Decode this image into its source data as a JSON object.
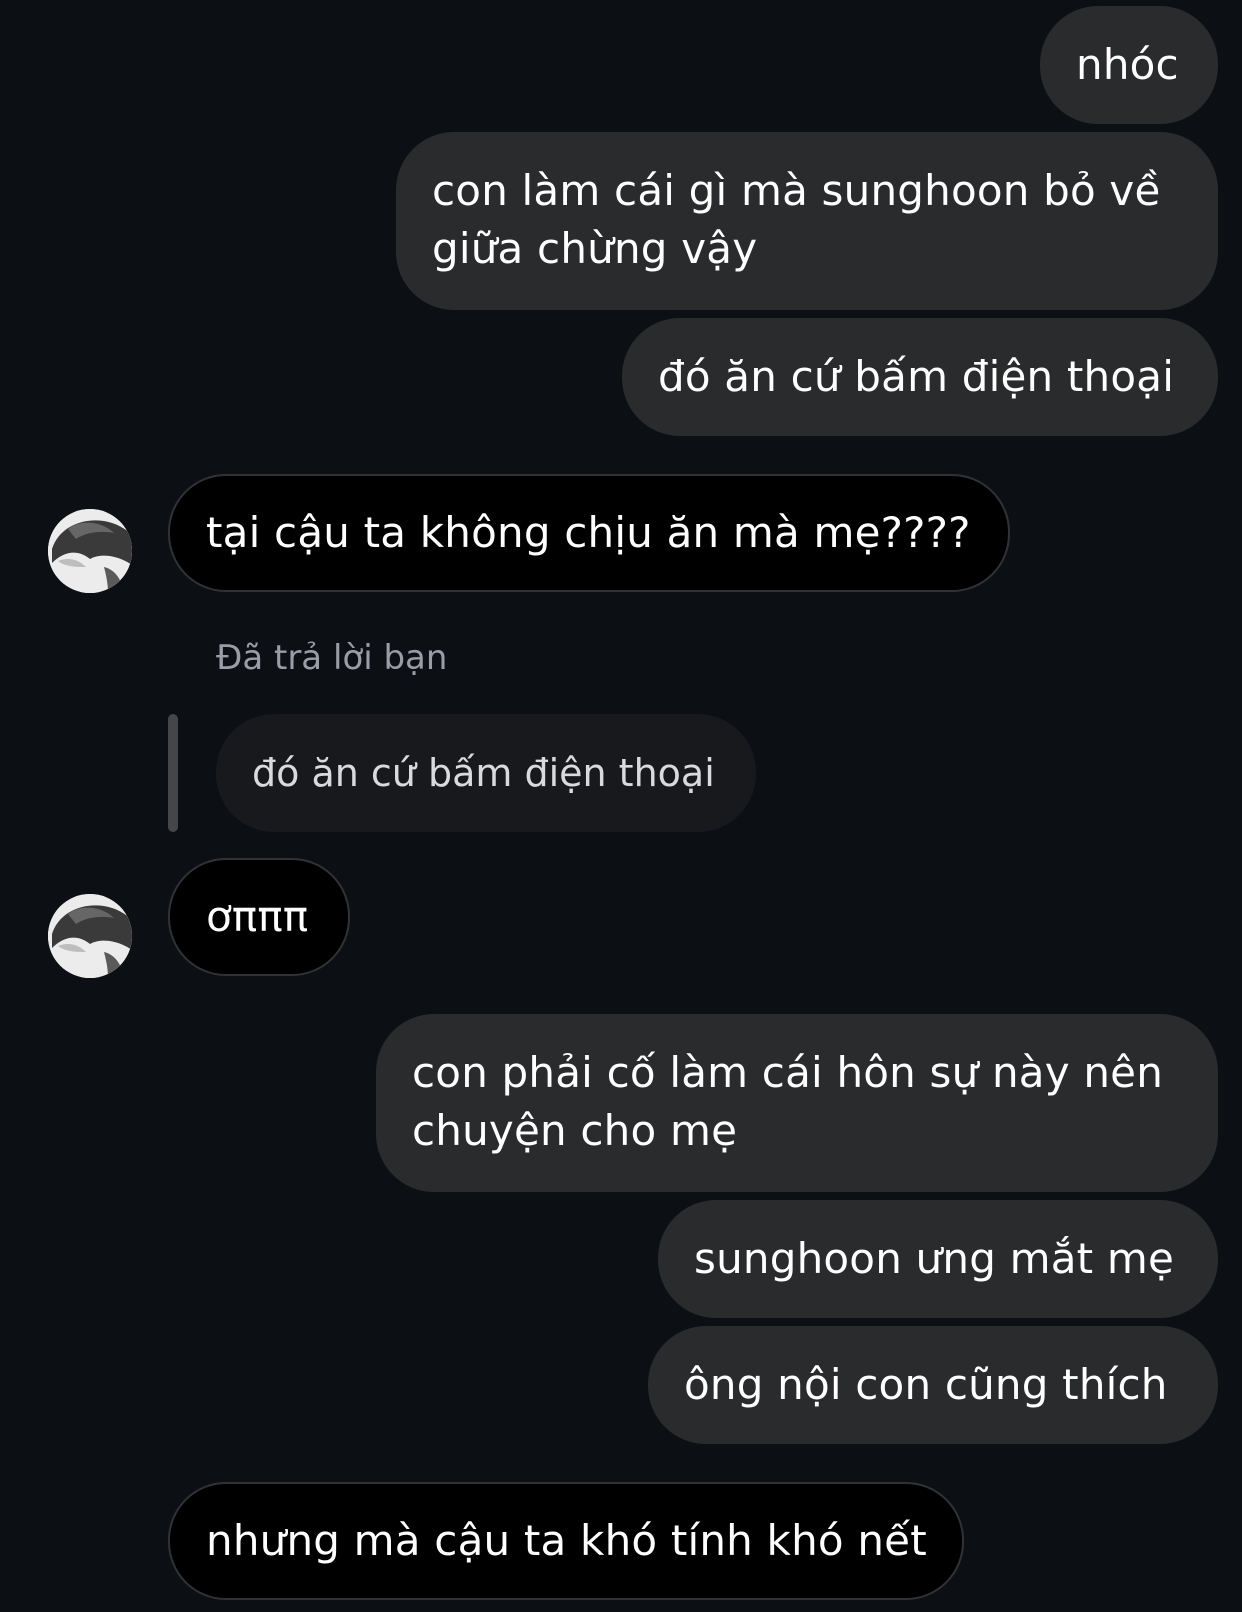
{
  "messages": {
    "m1": "nhóc",
    "m2": "con làm cái gì mà sunghoon bỏ về giữa chừng vậy",
    "m3": "đó ăn cứ bấm điện thoại",
    "m4": "tại cậu ta không chịu ăn mà mẹ????",
    "reply_note": "Đã trả lời bạn",
    "quoted": "đó ăn cứ bấm điện thoại",
    "m5": "ơπππ",
    "m6": "con phải cố làm cái hôn sự này nên chuyện cho mẹ",
    "m7": "sunghoon ưng mắt mẹ",
    "m8": "ông nội con cũng thích",
    "m9": "nhưng mà cậu ta khó tính khó nết"
  },
  "colors": {
    "background": "#0c1015",
    "outgoing_bubble": "#2a2b2d",
    "incoming_bubble": "#000000",
    "quoted_bubble": "#17191d"
  }
}
